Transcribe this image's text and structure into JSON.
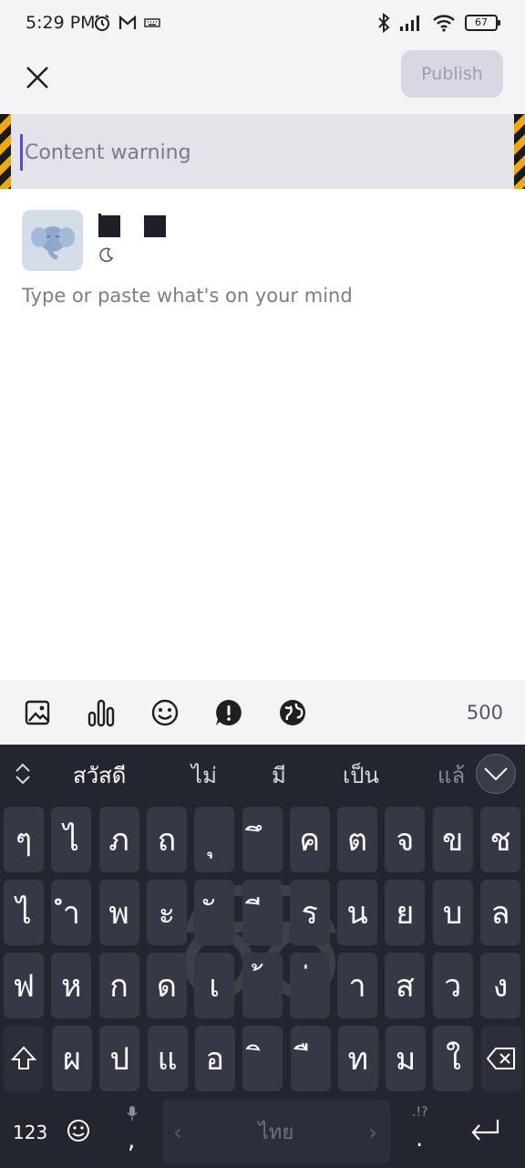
{
  "status_bar": {
    "time": "5:29 PM",
    "battery": "67",
    "left_icons": [
      "alarm-icon",
      "gmail-icon",
      "keyboard-icon"
    ],
    "right_icons": [
      "bluetooth-icon",
      "signal-icon",
      "wifi-icon",
      "battery-icon"
    ]
  },
  "app_bar": {
    "close_icon": "close-icon",
    "publish_label": "Publish"
  },
  "content_warning": {
    "placeholder": "Content warning"
  },
  "composer": {
    "avatar_icon": "mastodon-elephant-icon",
    "handle_icon": "moon-icon",
    "placeholder": "Type or paste what's on your mind"
  },
  "toolbar": {
    "icons": [
      "image-icon",
      "poll-icon",
      "emoji-icon",
      "content-warning-icon",
      "globe-visibility-icon"
    ],
    "char_count": "500"
  },
  "keyboard": {
    "suggestions": [
      "สวัสดี",
      "ไม่",
      "มี",
      "เป็น",
      "แล้"
    ],
    "rows": [
      [
        "ๆ",
        "ไ",
        "ภ",
        "ถ",
        "ุ",
        "ึ",
        "ค",
        "ต",
        "จ",
        "ข",
        "ช"
      ],
      [
        "ไ",
        "ำ",
        "พ",
        "ะ",
        "ั",
        "ี",
        "ร",
        "น",
        "ย",
        "บ",
        "ล"
      ],
      [
        "ฟ",
        "ห",
        "ก",
        "ด",
        "เ",
        "้",
        "่",
        "า",
        "ส",
        "ว",
        "ง"
      ],
      [
        "ผ",
        "ป",
        "แ",
        "อ",
        "ิ",
        "ื",
        "ท",
        "ม",
        "ใ"
      ]
    ],
    "numbers_label": "123",
    "comma_label": ",",
    "period_label": ".",
    "punct_hint": ".!?",
    "space_label": "ไทย",
    "accent_color": "#23252f"
  }
}
